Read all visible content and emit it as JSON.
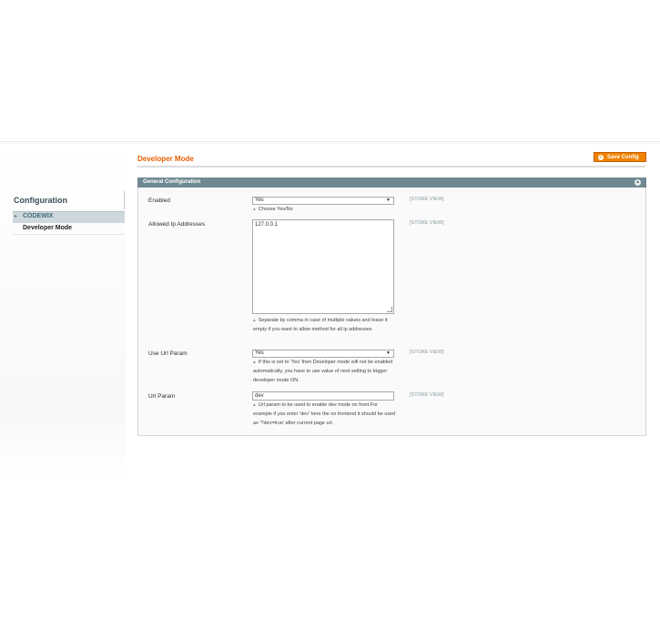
{
  "header": {
    "page_title": "Developer Mode",
    "save_label": "Save Config"
  },
  "sidebar": {
    "title": "Configuration",
    "group": "CODEWIX",
    "items": [
      "Developer Mode"
    ]
  },
  "section": {
    "title": "General Configuration"
  },
  "fields": {
    "enabled": {
      "label": "Enabled",
      "value": "Yes",
      "scope": "[STORE VIEW]",
      "note": "Choose Yes/No"
    },
    "allowed_ips": {
      "label": "Allowed Ip Addresses",
      "value": "127.0.0.1",
      "scope": "[STORE VIEW]",
      "note": "Separate by comma in case of multiple values and leave it empty if you want to allow method for all ip addresses"
    },
    "use_url_param": {
      "label": "Use Url Param",
      "value": "Yes",
      "scope": "[STORE VIEW]",
      "note": "If this is set to 'Yes' then Developer mode will not be enabled automatically, you have to use value of next setting to trigger developer mode ON."
    },
    "url_param": {
      "label": "Url Param",
      "value": "dev",
      "scope": "[STORE VIEW]",
      "note": "Url param to be used to enable dev mode on front.For example if you enter 'dev' here the on frontend it should be used as '?dev=true' after current page url."
    }
  },
  "colors": {
    "accent": "#eb5e00",
    "button": "#f18200",
    "section_header": "#6f8992"
  },
  "icons": {
    "save": "check-circle-icon",
    "collapse": "collapse-icon",
    "select_caret": "caret-down-icon",
    "note_bullet": "triangle-bullet-icon"
  }
}
